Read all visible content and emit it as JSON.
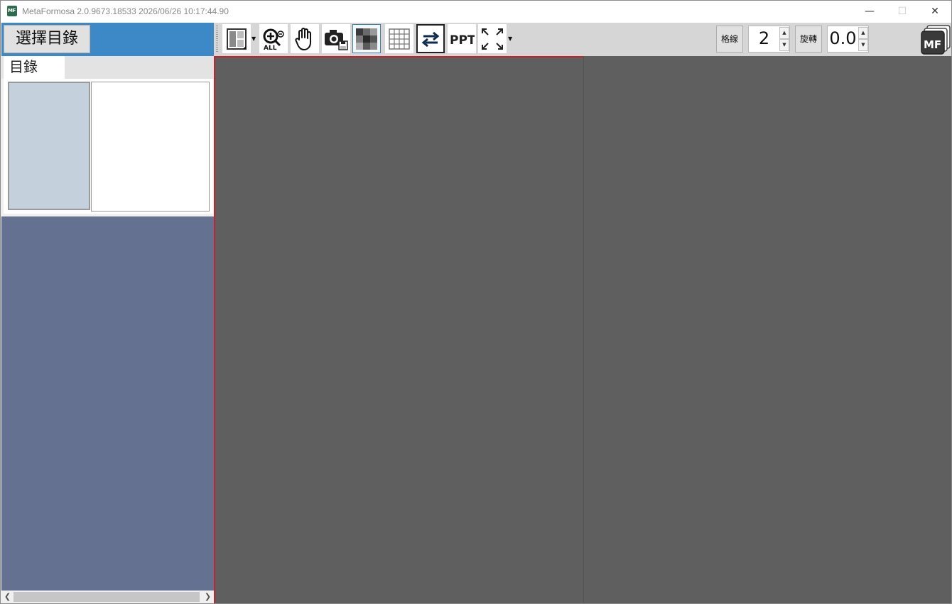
{
  "window": {
    "title": "MetaFormosa 2.0.9673.18533 2026/06/26 10:17:44.90",
    "minimize_glyph": "—",
    "maximize_glyph": "☐",
    "close_glyph": "✕"
  },
  "left_panel": {
    "select_dir_label": "選擇目錄",
    "tab_label": "目錄"
  },
  "toolbar": {
    "buttons": [
      {
        "icon": "layout-icon",
        "has_dropdown": true
      },
      {
        "icon": "zoom-all-icon",
        "text": "ALL"
      },
      {
        "icon": "hand-pan-icon"
      },
      {
        "icon": "camera-save-icon"
      },
      {
        "icon": "mosaic-icon",
        "selected": true
      },
      {
        "icon": "grid-icon"
      },
      {
        "icon": "swap-arrows-icon"
      },
      {
        "icon": "ppt-icon",
        "text": "PPT"
      },
      {
        "icon": "fullscreen-icon",
        "has_dropdown": true
      }
    ],
    "grid_label": "格線",
    "grid_value": "2",
    "rotate_label": "旋轉",
    "rotate_value": "0.0",
    "spin_up": "▲",
    "spin_down": "▼",
    "logo_text": "MF"
  },
  "colors": {
    "left_header_blue": "#3d88c6",
    "left_panel_blue": "#647191",
    "view_gray": "#5f5f5f",
    "active_border_red": "#c0272d"
  }
}
